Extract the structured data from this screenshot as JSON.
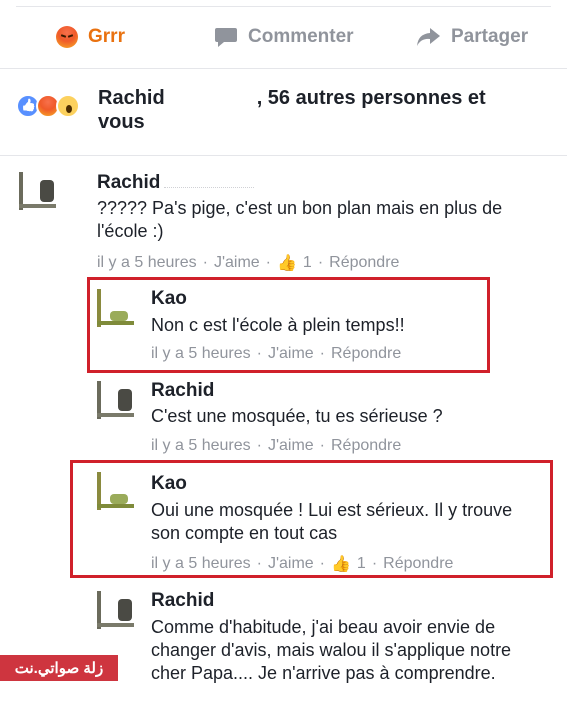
{
  "actions": {
    "grrr_label": "Grrr",
    "comment_label": "Commenter",
    "share_label": "Partager"
  },
  "reactions": {
    "name": "Rachid",
    "rest": ", 56 autres personnes et vous"
  },
  "comments": [
    {
      "author": "Rachid",
      "text": "????? Pa's pige, c'est un bon plan mais en plus de l'école :)",
      "time": "il y a 5 heures",
      "like": "J'aime",
      "likes": "1",
      "reply": "Répondre"
    },
    {
      "author": "Kao",
      "text": "Non c est l'école à plein temps!!",
      "time": "il y a 5 heures",
      "like": "J'aime",
      "reply": "Répondre"
    },
    {
      "author": "Rachid",
      "text": "C'est une mosquée, tu es sérieuse ?",
      "time": "il y a 5 heures",
      "like": "J'aime",
      "reply": "Répondre"
    },
    {
      "author": "Kao",
      "text": "Oui une mosquée !  Lui est sérieux.   Il y trouve son compte en tout cas",
      "time": "il y a 5 heures",
      "like": "J'aime",
      "likes": "1",
      "reply": "Répondre"
    },
    {
      "author": "Rachid",
      "text": "Comme d'habitude, j'ai beau avoir envie de changer d'avis, mais walou il s'applique notre cher Papa.... Je n'arrive pas à comprendre."
    }
  ],
  "watermark": "زلة صواتي.نت",
  "colors": {
    "accent_grrr": "#e9710f",
    "meta_gray": "#90949c",
    "highlight_red": "#d0202a",
    "like_blue": "#5890ff"
  }
}
